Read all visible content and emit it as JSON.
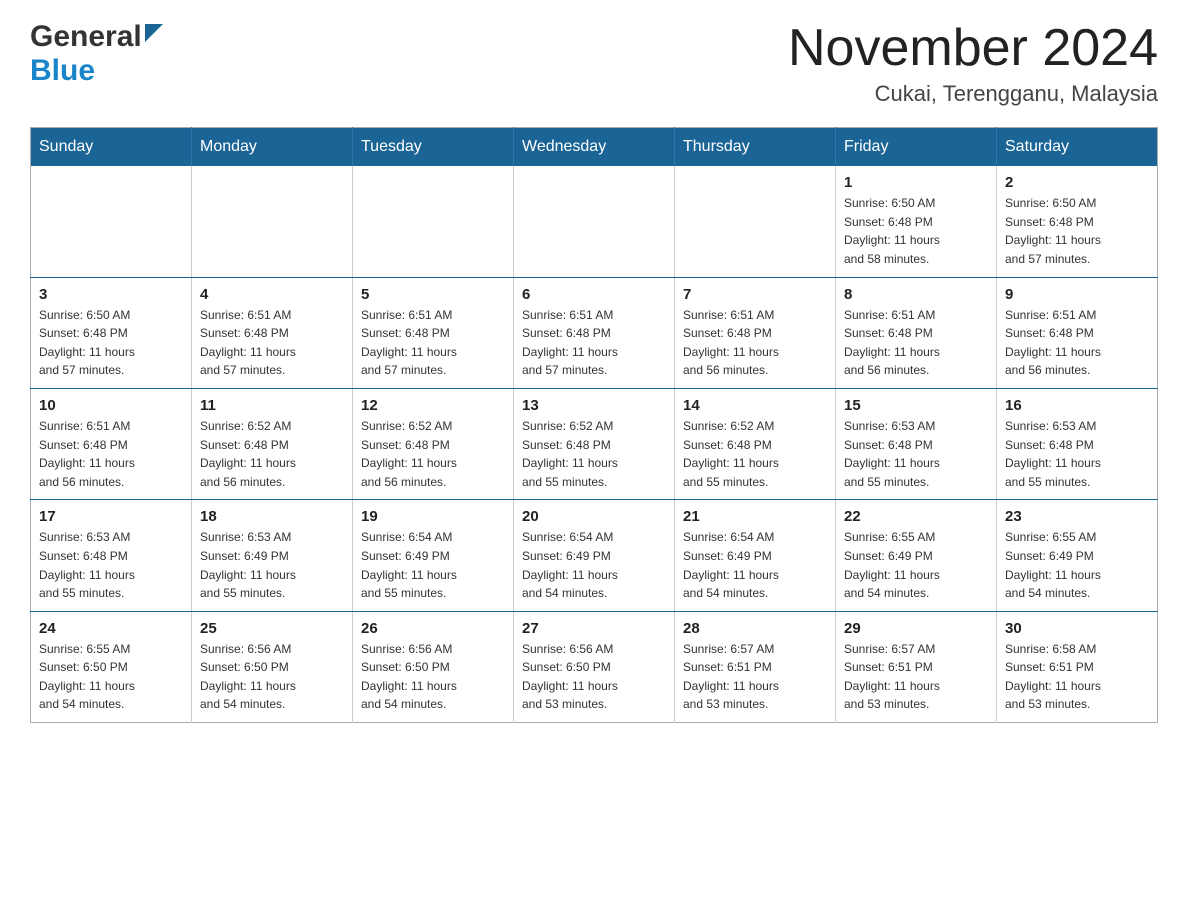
{
  "header": {
    "logo_general": "General",
    "logo_blue": "Blue",
    "month_title": "November 2024",
    "location": "Cukai, Terengganu, Malaysia"
  },
  "days_of_week": [
    "Sunday",
    "Monday",
    "Tuesday",
    "Wednesday",
    "Thursday",
    "Friday",
    "Saturday"
  ],
  "weeks": [
    [
      {
        "day": "",
        "info": ""
      },
      {
        "day": "",
        "info": ""
      },
      {
        "day": "",
        "info": ""
      },
      {
        "day": "",
        "info": ""
      },
      {
        "day": "",
        "info": ""
      },
      {
        "day": "1",
        "info": "Sunrise: 6:50 AM\nSunset: 6:48 PM\nDaylight: 11 hours\nand 58 minutes."
      },
      {
        "day": "2",
        "info": "Sunrise: 6:50 AM\nSunset: 6:48 PM\nDaylight: 11 hours\nand 57 minutes."
      }
    ],
    [
      {
        "day": "3",
        "info": "Sunrise: 6:50 AM\nSunset: 6:48 PM\nDaylight: 11 hours\nand 57 minutes."
      },
      {
        "day": "4",
        "info": "Sunrise: 6:51 AM\nSunset: 6:48 PM\nDaylight: 11 hours\nand 57 minutes."
      },
      {
        "day": "5",
        "info": "Sunrise: 6:51 AM\nSunset: 6:48 PM\nDaylight: 11 hours\nand 57 minutes."
      },
      {
        "day": "6",
        "info": "Sunrise: 6:51 AM\nSunset: 6:48 PM\nDaylight: 11 hours\nand 57 minutes."
      },
      {
        "day": "7",
        "info": "Sunrise: 6:51 AM\nSunset: 6:48 PM\nDaylight: 11 hours\nand 56 minutes."
      },
      {
        "day": "8",
        "info": "Sunrise: 6:51 AM\nSunset: 6:48 PM\nDaylight: 11 hours\nand 56 minutes."
      },
      {
        "day": "9",
        "info": "Sunrise: 6:51 AM\nSunset: 6:48 PM\nDaylight: 11 hours\nand 56 minutes."
      }
    ],
    [
      {
        "day": "10",
        "info": "Sunrise: 6:51 AM\nSunset: 6:48 PM\nDaylight: 11 hours\nand 56 minutes."
      },
      {
        "day": "11",
        "info": "Sunrise: 6:52 AM\nSunset: 6:48 PM\nDaylight: 11 hours\nand 56 minutes."
      },
      {
        "day": "12",
        "info": "Sunrise: 6:52 AM\nSunset: 6:48 PM\nDaylight: 11 hours\nand 56 minutes."
      },
      {
        "day": "13",
        "info": "Sunrise: 6:52 AM\nSunset: 6:48 PM\nDaylight: 11 hours\nand 55 minutes."
      },
      {
        "day": "14",
        "info": "Sunrise: 6:52 AM\nSunset: 6:48 PM\nDaylight: 11 hours\nand 55 minutes."
      },
      {
        "day": "15",
        "info": "Sunrise: 6:53 AM\nSunset: 6:48 PM\nDaylight: 11 hours\nand 55 minutes."
      },
      {
        "day": "16",
        "info": "Sunrise: 6:53 AM\nSunset: 6:48 PM\nDaylight: 11 hours\nand 55 minutes."
      }
    ],
    [
      {
        "day": "17",
        "info": "Sunrise: 6:53 AM\nSunset: 6:48 PM\nDaylight: 11 hours\nand 55 minutes."
      },
      {
        "day": "18",
        "info": "Sunrise: 6:53 AM\nSunset: 6:49 PM\nDaylight: 11 hours\nand 55 minutes."
      },
      {
        "day": "19",
        "info": "Sunrise: 6:54 AM\nSunset: 6:49 PM\nDaylight: 11 hours\nand 55 minutes."
      },
      {
        "day": "20",
        "info": "Sunrise: 6:54 AM\nSunset: 6:49 PM\nDaylight: 11 hours\nand 54 minutes."
      },
      {
        "day": "21",
        "info": "Sunrise: 6:54 AM\nSunset: 6:49 PM\nDaylight: 11 hours\nand 54 minutes."
      },
      {
        "day": "22",
        "info": "Sunrise: 6:55 AM\nSunset: 6:49 PM\nDaylight: 11 hours\nand 54 minutes."
      },
      {
        "day": "23",
        "info": "Sunrise: 6:55 AM\nSunset: 6:49 PM\nDaylight: 11 hours\nand 54 minutes."
      }
    ],
    [
      {
        "day": "24",
        "info": "Sunrise: 6:55 AM\nSunset: 6:50 PM\nDaylight: 11 hours\nand 54 minutes."
      },
      {
        "day": "25",
        "info": "Sunrise: 6:56 AM\nSunset: 6:50 PM\nDaylight: 11 hours\nand 54 minutes."
      },
      {
        "day": "26",
        "info": "Sunrise: 6:56 AM\nSunset: 6:50 PM\nDaylight: 11 hours\nand 54 minutes."
      },
      {
        "day": "27",
        "info": "Sunrise: 6:56 AM\nSunset: 6:50 PM\nDaylight: 11 hours\nand 53 minutes."
      },
      {
        "day": "28",
        "info": "Sunrise: 6:57 AM\nSunset: 6:51 PM\nDaylight: 11 hours\nand 53 minutes."
      },
      {
        "day": "29",
        "info": "Sunrise: 6:57 AM\nSunset: 6:51 PM\nDaylight: 11 hours\nand 53 minutes."
      },
      {
        "day": "30",
        "info": "Sunrise: 6:58 AM\nSunset: 6:51 PM\nDaylight: 11 hours\nand 53 minutes."
      }
    ]
  ]
}
